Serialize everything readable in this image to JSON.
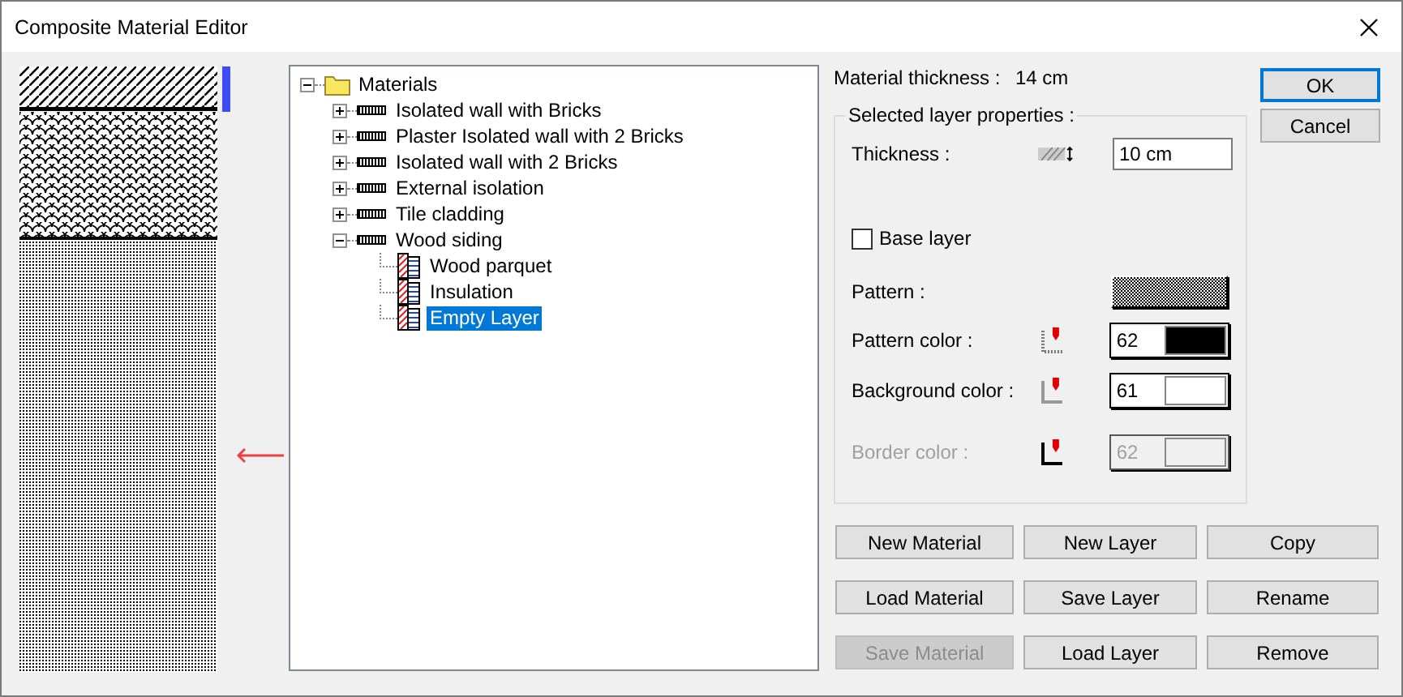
{
  "window": {
    "title": "Composite Material Editor"
  },
  "tree": {
    "label": "Materials",
    "expanded": true,
    "children": [
      {
        "label": "Isolated wall with Bricks",
        "expanded": false,
        "selected": false
      },
      {
        "label": "Plaster Isolated wall with 2 Bricks",
        "expanded": false,
        "selected": false
      },
      {
        "label": "Isolated wall with 2 Bricks",
        "expanded": false,
        "selected": false
      },
      {
        "label": "External isolation",
        "expanded": false,
        "selected": false
      },
      {
        "label": "Tile cladding",
        "expanded": false,
        "selected": false
      },
      {
        "label": "Wood siding",
        "expanded": true,
        "selected": false,
        "children": [
          {
            "label": "Wood parquet",
            "selected": false
          },
          {
            "label": "Insulation",
            "selected": false
          },
          {
            "label": "Empty Layer",
            "selected": true
          }
        ]
      }
    ]
  },
  "material_thickness": {
    "label": "Material thickness :",
    "value": "14 cm"
  },
  "layer_properties": {
    "title": "Selected layer properties :",
    "thickness": {
      "label": "Thickness :",
      "value": "10 cm"
    },
    "base_layer": {
      "label": "Base layer",
      "checked": false
    },
    "pattern": {
      "label": "Pattern :"
    },
    "colors": [
      {
        "label": "Pattern color :",
        "value": "62",
        "color": "#000000",
        "disabled": false
      },
      {
        "label": "Background color :",
        "value": "61",
        "color": "#ffffff",
        "disabled": false
      },
      {
        "label": "Border color :",
        "value": "62",
        "color": "#f0f0f0",
        "disabled": true
      }
    ]
  },
  "dialog_buttons": [
    {
      "label": "OK",
      "default": true
    },
    {
      "label": "Cancel",
      "default": false
    }
  ],
  "buttons": [
    {
      "label": "New Material",
      "disabled": false
    },
    {
      "label": "New Layer",
      "disabled": false
    },
    {
      "label": "Copy",
      "disabled": false
    },
    {
      "label": "Load Material",
      "disabled": false
    },
    {
      "label": "Save Layer",
      "disabled": false
    },
    {
      "label": "Rename",
      "disabled": false
    },
    {
      "label": "Save Material",
      "disabled": true
    },
    {
      "label": "Load Layer",
      "disabled": false
    },
    {
      "label": "Remove",
      "disabled": false
    }
  ]
}
